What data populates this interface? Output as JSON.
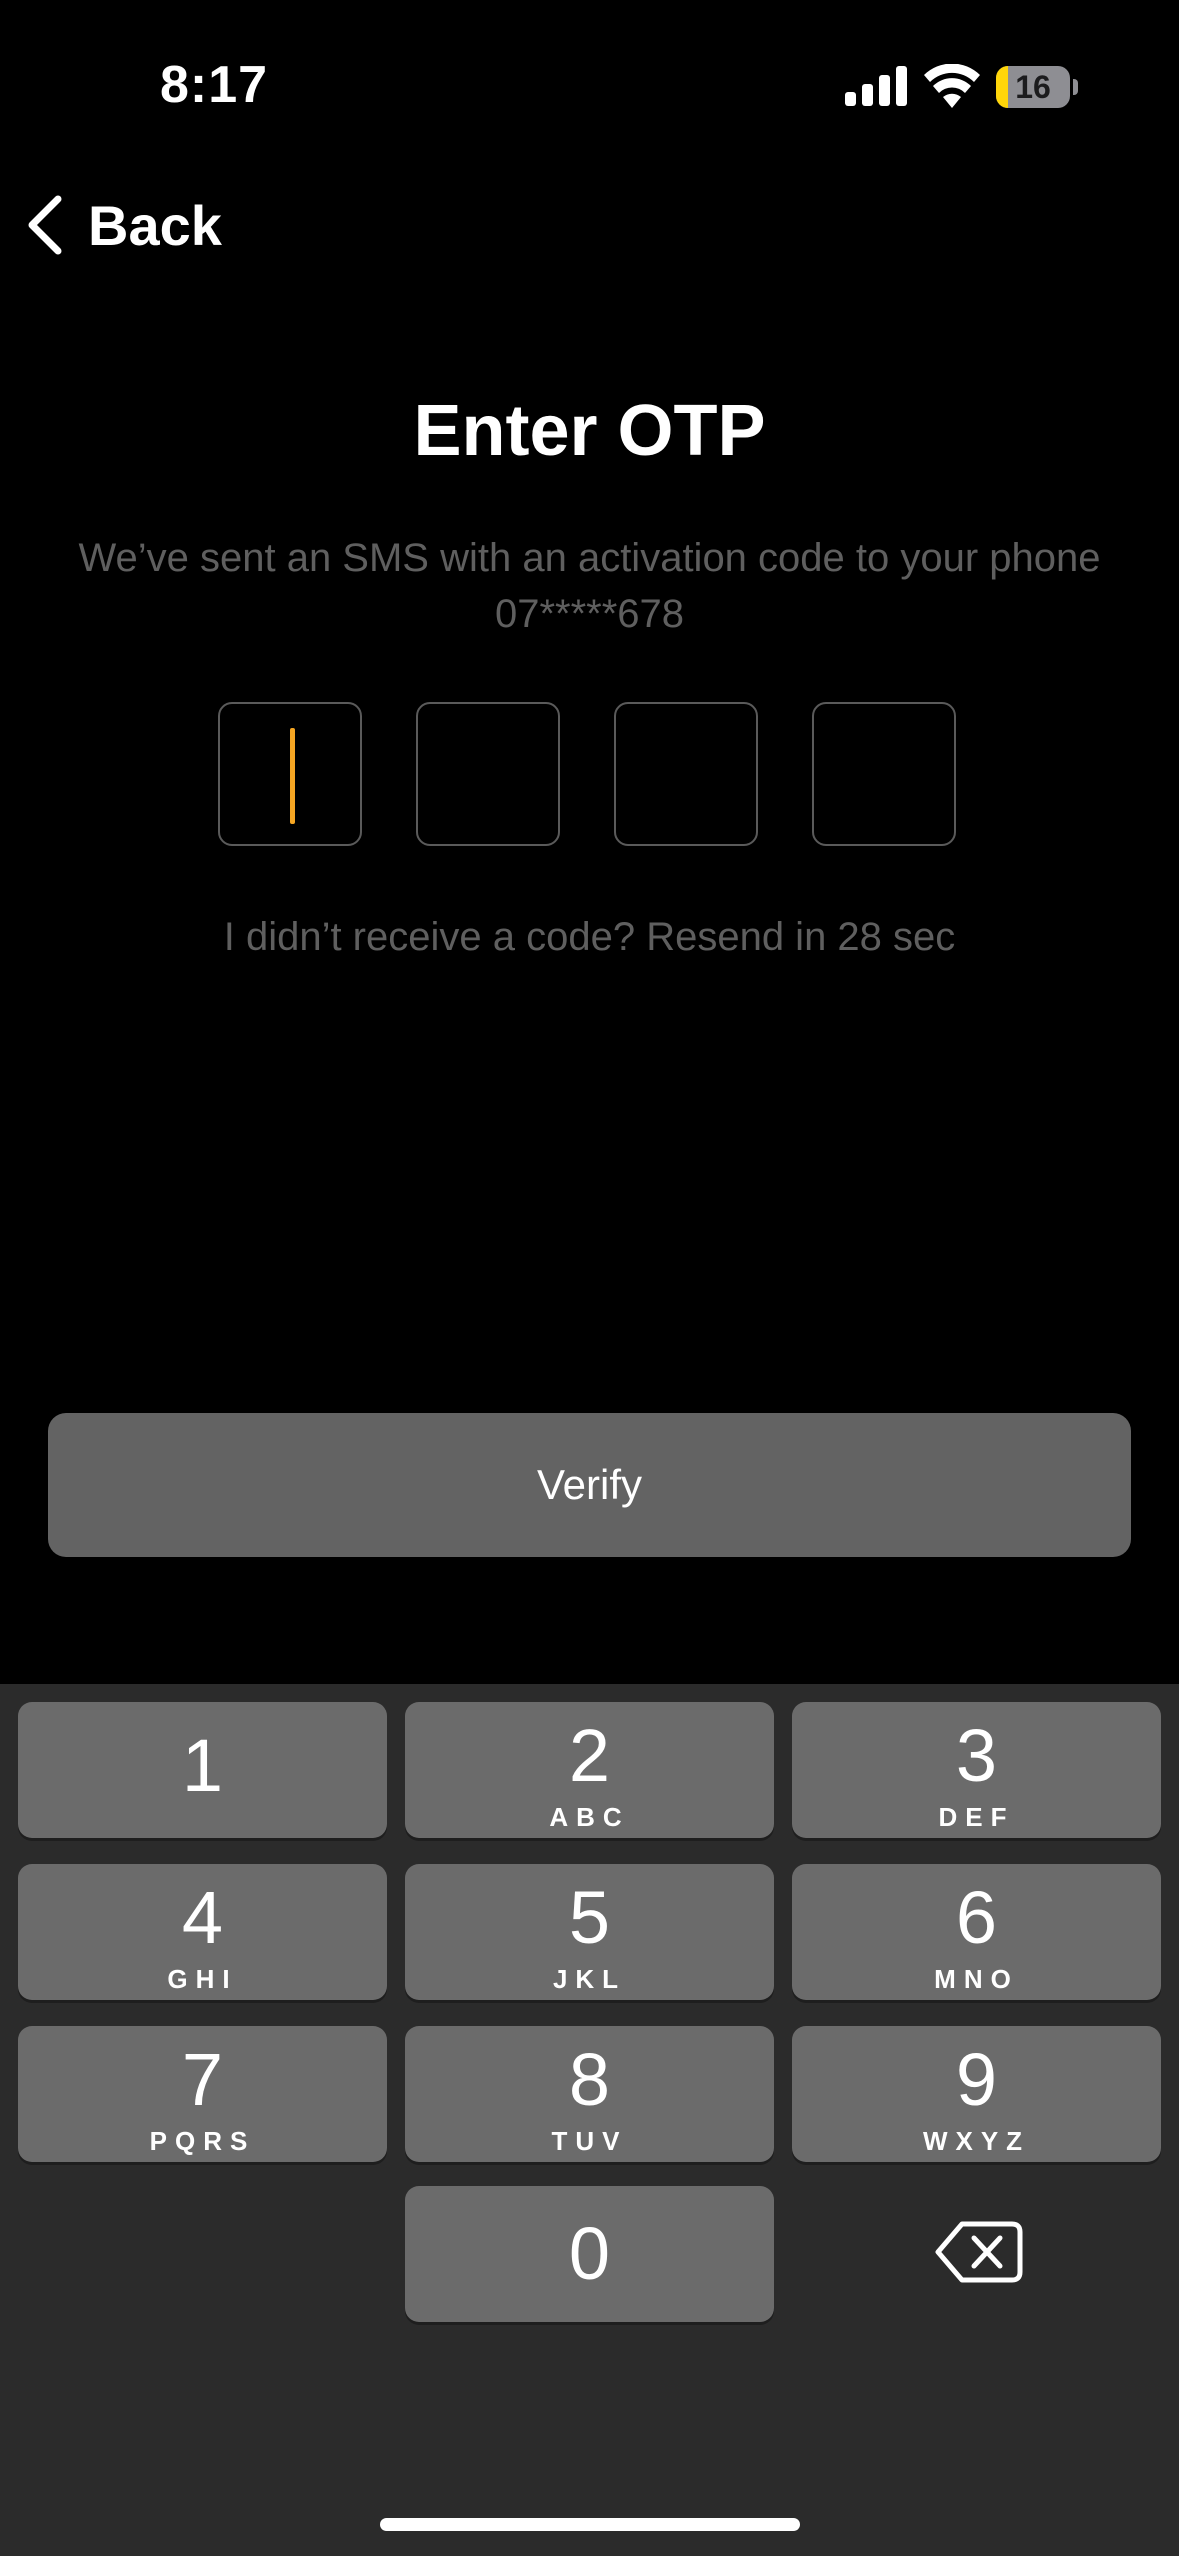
{
  "status_bar": {
    "time": "8:17",
    "battery_level": "16",
    "battery_fraction": 0.16,
    "signal_icon": "cellular-signal-icon",
    "wifi_icon": "wifi-icon",
    "battery_color": "#ffd60a"
  },
  "nav": {
    "back_label": "Back",
    "back_icon": "chevron-left-icon"
  },
  "page": {
    "title": "Enter OTP",
    "subtitle_line1": "We’ve sent an SMS with an activation code to your phone",
    "subtitle_line2": "07*****678",
    "otp_digits": [
      "",
      "",
      "",
      ""
    ],
    "resend_text": "I didn’t receive a code? Resend in 28 sec",
    "verify_label": "Verify",
    "accent_color": "#f5a623"
  },
  "keyboard": {
    "keys": [
      {
        "num": "1",
        "letters": ""
      },
      {
        "num": "2",
        "letters": "ABC"
      },
      {
        "num": "3",
        "letters": "DEF"
      },
      {
        "num": "4",
        "letters": "GHI"
      },
      {
        "num": "5",
        "letters": "JKL"
      },
      {
        "num": "6",
        "letters": "MNO"
      },
      {
        "num": "7",
        "letters": "PQRS"
      },
      {
        "num": "8",
        "letters": "TUV"
      },
      {
        "num": "9",
        "letters": "WXYZ"
      },
      {
        "num": "0",
        "letters": ""
      }
    ],
    "delete_icon": "backspace-icon"
  }
}
